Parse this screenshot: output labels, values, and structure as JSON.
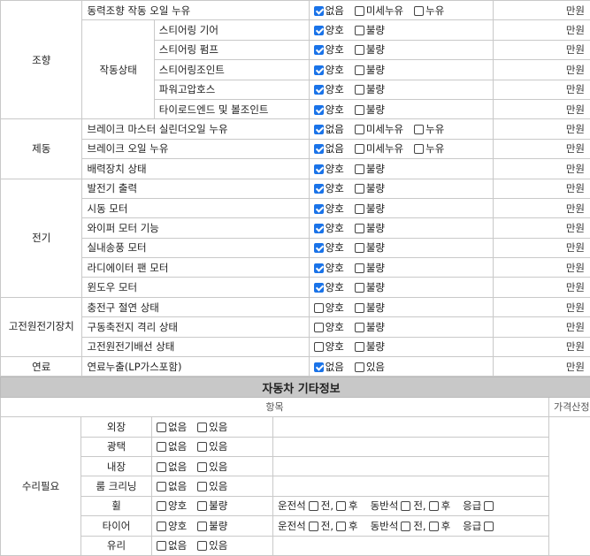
{
  "units": "만원",
  "labels": {
    "good": "양호",
    "bad": "불량",
    "none": "없음",
    "minor": "미세누유",
    "leak": "누유",
    "exists": "있음",
    "before": "전,",
    "after": "후",
    "before2": "전,"
  },
  "steering": {
    "category": "조향",
    "power_oil": "동력조향 작동 오일 누유",
    "sub_category": "작동상태",
    "items": [
      "스티어링 기어",
      "스티어링 펌프",
      "스티어링조인트",
      "파워고압호스",
      "타이로드엔드 및 볼조인트"
    ]
  },
  "brake": {
    "category": "제동",
    "items": [
      "브레이크 마스터 실린더오일 누유",
      "브레이크 오일 누유",
      "배력장치 상태"
    ]
  },
  "electric": {
    "category": "전기",
    "items": [
      "발전기 출력",
      "시동 모터",
      "와이퍼 모터 기능",
      "실내송풍 모터",
      "라디에이터 팬 모터",
      "윈도우 모터"
    ]
  },
  "hv": {
    "category": "고전원전기장치",
    "items": [
      "충전구 절연 상태",
      "구동축전지 격리 상태",
      "고전원전기배선 상태"
    ]
  },
  "fuel": {
    "category": "연료",
    "item": "연료누출(LP가스포함)"
  },
  "other": {
    "title": "자동차 기타정보",
    "col_item": "항목",
    "col_price": "가격산정",
    "repair_label": "수리필요",
    "rows": [
      "외장",
      "광택",
      "내장",
      "룸 크리닝",
      "휠",
      "타이어",
      "유리"
    ],
    "seat_driver": "운전석",
    "seat_passenger": "동반석",
    "urgent": "응급"
  }
}
